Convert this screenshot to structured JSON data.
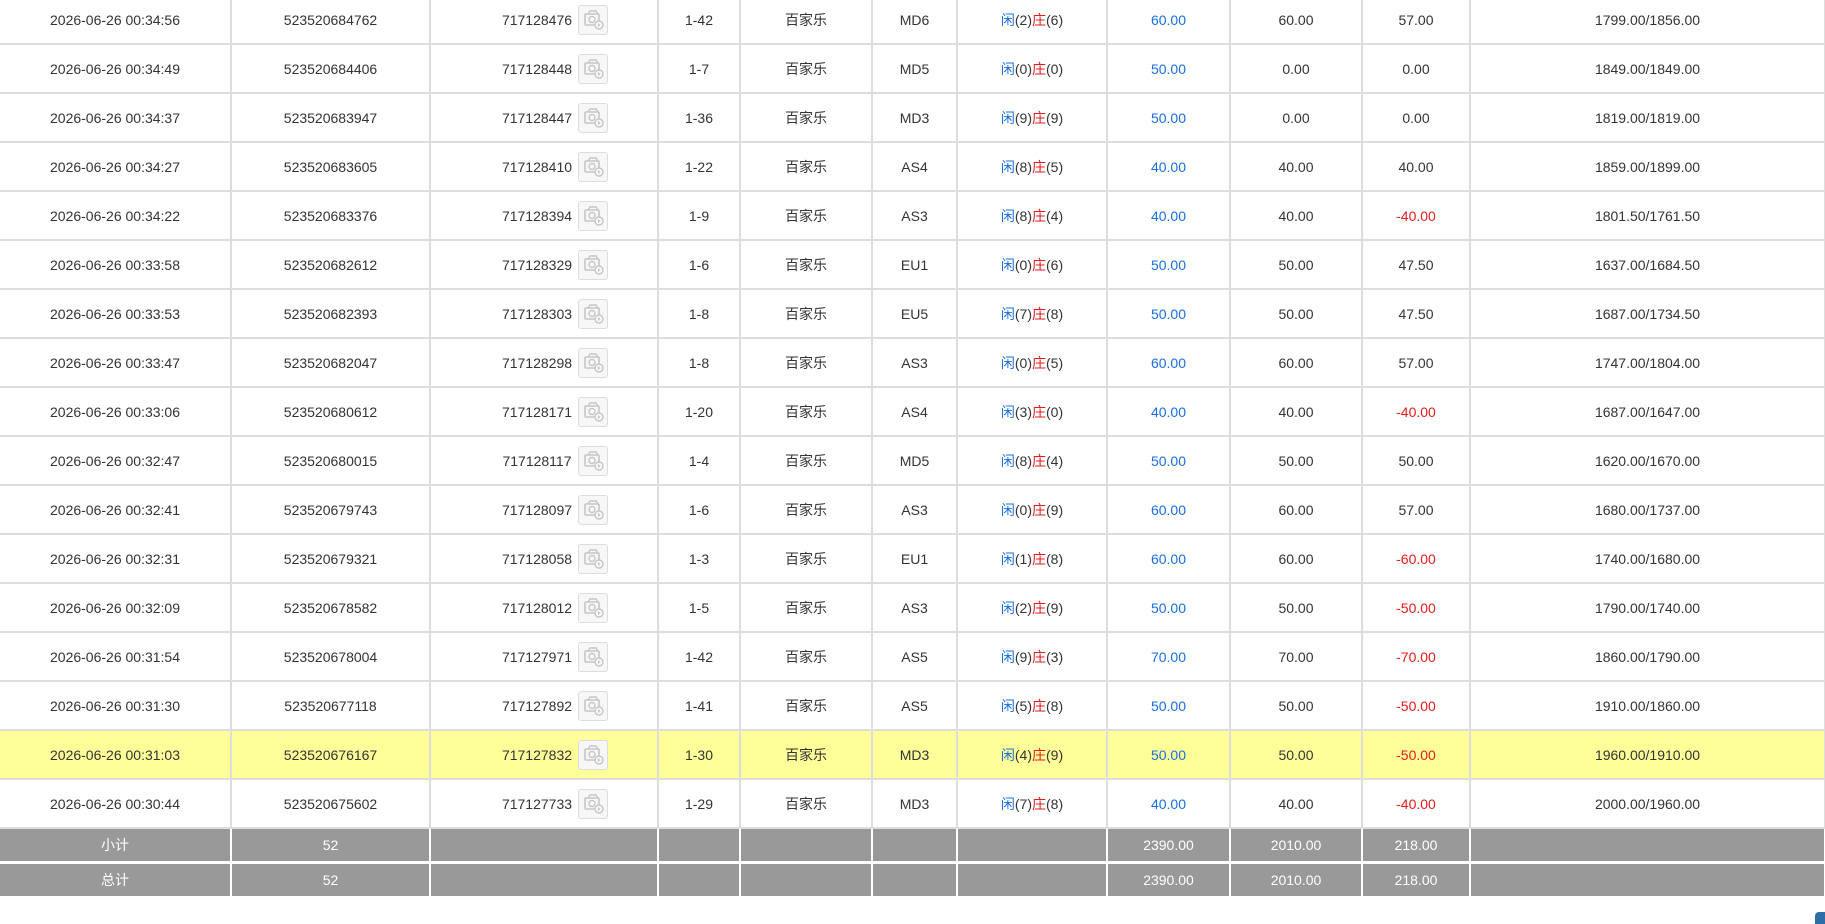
{
  "rows": [
    {
      "time": "2026-06-26 00:34:56",
      "bet_id": "523520684762",
      "game_id": "717128476",
      "shoe": "1-42",
      "game": "百家乐",
      "table": "MD6",
      "result": {
        "player_label": "闲",
        "player": "(2)",
        "banker_label": "庄",
        "banker": "(6)"
      },
      "bet": "60.00",
      "valid": "60.00",
      "winloss": "57.00",
      "winloss_negative": false,
      "balance": "1799.00/1856.00"
    },
    {
      "time": "2026-06-26 00:34:49",
      "bet_id": "523520684406",
      "game_id": "717128448",
      "shoe": "1-7",
      "game": "百家乐",
      "table": "MD5",
      "result": {
        "player_label": "闲",
        "player": "(0)",
        "banker_label": "庄",
        "banker": "(0)"
      },
      "bet": "50.00",
      "valid": "0.00",
      "winloss": "0.00",
      "winloss_negative": false,
      "balance": "1849.00/1849.00"
    },
    {
      "time": "2026-06-26 00:34:37",
      "bet_id": "523520683947",
      "game_id": "717128447",
      "shoe": "1-36",
      "game": "百家乐",
      "table": "MD3",
      "result": {
        "player_label": "闲",
        "player": "(9)",
        "banker_label": "庄",
        "banker": "(9)"
      },
      "bet": "50.00",
      "valid": "0.00",
      "winloss": "0.00",
      "winloss_negative": false,
      "balance": "1819.00/1819.00"
    },
    {
      "time": "2026-06-26 00:34:27",
      "bet_id": "523520683605",
      "game_id": "717128410",
      "shoe": "1-22",
      "game": "百家乐",
      "table": "AS4",
      "result": {
        "player_label": "闲",
        "player": "(8)",
        "banker_label": "庄",
        "banker": "(5)"
      },
      "bet": "40.00",
      "valid": "40.00",
      "winloss": "40.00",
      "winloss_negative": false,
      "balance": "1859.00/1899.00"
    },
    {
      "time": "2026-06-26 00:34:22",
      "bet_id": "523520683376",
      "game_id": "717128394",
      "shoe": "1-9",
      "game": "百家乐",
      "table": "AS3",
      "result": {
        "player_label": "闲",
        "player": "(8)",
        "banker_label": "庄",
        "banker": "(4)"
      },
      "bet": "40.00",
      "valid": "40.00",
      "winloss": "-40.00",
      "winloss_negative": true,
      "balance": "1801.50/1761.50"
    },
    {
      "time": "2026-06-26 00:33:58",
      "bet_id": "523520682612",
      "game_id": "717128329",
      "shoe": "1-6",
      "game": "百家乐",
      "table": "EU1",
      "result": {
        "player_label": "闲",
        "player": "(0)",
        "banker_label": "庄",
        "banker": "(6)"
      },
      "bet": "50.00",
      "valid": "50.00",
      "winloss": "47.50",
      "winloss_negative": false,
      "balance": "1637.00/1684.50"
    },
    {
      "time": "2026-06-26 00:33:53",
      "bet_id": "523520682393",
      "game_id": "717128303",
      "shoe": "1-8",
      "game": "百家乐",
      "table": "EU5",
      "result": {
        "player_label": "闲",
        "player": "(7)",
        "banker_label": "庄",
        "banker": "(8)"
      },
      "bet": "50.00",
      "valid": "50.00",
      "winloss": "47.50",
      "winloss_negative": false,
      "balance": "1687.00/1734.50"
    },
    {
      "time": "2026-06-26 00:33:47",
      "bet_id": "523520682047",
      "game_id": "717128298",
      "shoe": "1-8",
      "game": "百家乐",
      "table": "AS3",
      "result": {
        "player_label": "闲",
        "player": "(0)",
        "banker_label": "庄",
        "banker": "(5)"
      },
      "bet": "60.00",
      "valid": "60.00",
      "winloss": "57.00",
      "winloss_negative": false,
      "balance": "1747.00/1804.00"
    },
    {
      "time": "2026-06-26 00:33:06",
      "bet_id": "523520680612",
      "game_id": "717128171",
      "shoe": "1-20",
      "game": "百家乐",
      "table": "AS4",
      "result": {
        "player_label": "闲",
        "player": "(3)",
        "banker_label": "庄",
        "banker": "(0)"
      },
      "bet": "40.00",
      "valid": "40.00",
      "winloss": "-40.00",
      "winloss_negative": true,
      "balance": "1687.00/1647.00"
    },
    {
      "time": "2026-06-26 00:32:47",
      "bet_id": "523520680015",
      "game_id": "717128117",
      "shoe": "1-4",
      "game": "百家乐",
      "table": "MD5",
      "result": {
        "player_label": "闲",
        "player": "(8)",
        "banker_label": "庄",
        "banker": "(4)"
      },
      "bet": "50.00",
      "valid": "50.00",
      "winloss": "50.00",
      "winloss_negative": false,
      "balance": "1620.00/1670.00"
    },
    {
      "time": "2026-06-26 00:32:41",
      "bet_id": "523520679743",
      "game_id": "717128097",
      "shoe": "1-6",
      "game": "百家乐",
      "table": "AS3",
      "result": {
        "player_label": "闲",
        "player": "(0)",
        "banker_label": "庄",
        "banker": "(9)"
      },
      "bet": "60.00",
      "valid": "60.00",
      "winloss": "57.00",
      "winloss_negative": false,
      "balance": "1680.00/1737.00"
    },
    {
      "time": "2026-06-26 00:32:31",
      "bet_id": "523520679321",
      "game_id": "717128058",
      "shoe": "1-3",
      "game": "百家乐",
      "table": "EU1",
      "result": {
        "player_label": "闲",
        "player": "(1)",
        "banker_label": "庄",
        "banker": "(8)"
      },
      "bet": "60.00",
      "valid": "60.00",
      "winloss": "-60.00",
      "winloss_negative": true,
      "balance": "1740.00/1680.00"
    },
    {
      "time": "2026-06-26 00:32:09",
      "bet_id": "523520678582",
      "game_id": "717128012",
      "shoe": "1-5",
      "game": "百家乐",
      "table": "AS3",
      "result": {
        "player_label": "闲",
        "player": "(2)",
        "banker_label": "庄",
        "banker": "(9)"
      },
      "bet": "50.00",
      "valid": "50.00",
      "winloss": "-50.00",
      "winloss_negative": true,
      "balance": "1790.00/1740.00"
    },
    {
      "time": "2026-06-26 00:31:54",
      "bet_id": "523520678004",
      "game_id": "717127971",
      "shoe": "1-42",
      "game": "百家乐",
      "table": "AS5",
      "result": {
        "player_label": "闲",
        "player": "(9)",
        "banker_label": "庄",
        "banker": "(3)"
      },
      "bet": "70.00",
      "valid": "70.00",
      "winloss": "-70.00",
      "winloss_negative": true,
      "balance": "1860.00/1790.00"
    },
    {
      "time": "2026-06-26 00:31:30",
      "bet_id": "523520677118",
      "game_id": "717127892",
      "shoe": "1-41",
      "game": "百家乐",
      "table": "AS5",
      "result": {
        "player_label": "闲",
        "player": "(5)",
        "banker_label": "庄",
        "banker": "(8)"
      },
      "bet": "50.00",
      "valid": "50.00",
      "winloss": "-50.00",
      "winloss_negative": true,
      "balance": "1910.00/1860.00"
    },
    {
      "time": "2026-06-26 00:31:03",
      "bet_id": "523520676167",
      "game_id": "717127832",
      "shoe": "1-30",
      "game": "百家乐",
      "table": "MD3",
      "result": {
        "player_label": "闲",
        "player": "(4)",
        "banker_label": "庄",
        "banker": "(9)"
      },
      "bet": "50.00",
      "valid": "50.00",
      "winloss": "-50.00",
      "winloss_negative": true,
      "balance": "1960.00/1910.00",
      "highlighted": true
    },
    {
      "time": "2026-06-26 00:30:44",
      "bet_id": "523520675602",
      "game_id": "717127733",
      "shoe": "1-29",
      "game": "百家乐",
      "table": "MD3",
      "result": {
        "player_label": "闲",
        "player": "(7)",
        "banker_label": "庄",
        "banker": "(8)"
      },
      "bet": "40.00",
      "valid": "40.00",
      "winloss": "-40.00",
      "winloss_negative": true,
      "balance": "2000.00/1960.00"
    }
  ],
  "subtotal": {
    "label": "小计",
    "count": "52",
    "bet": "2390.00",
    "valid": "2010.00",
    "winloss": "218.00"
  },
  "total": {
    "label": "总计",
    "count": "52",
    "bet": "2390.00",
    "valid": "2010.00",
    "winloss": "218.00"
  },
  "colors": {
    "bet_amount": "#1a6fe0",
    "negative": "#e31b1b",
    "highlight_row": "#ffff99",
    "summary_row": "#999999"
  },
  "icons": {
    "replay": "video-replay-icon"
  }
}
